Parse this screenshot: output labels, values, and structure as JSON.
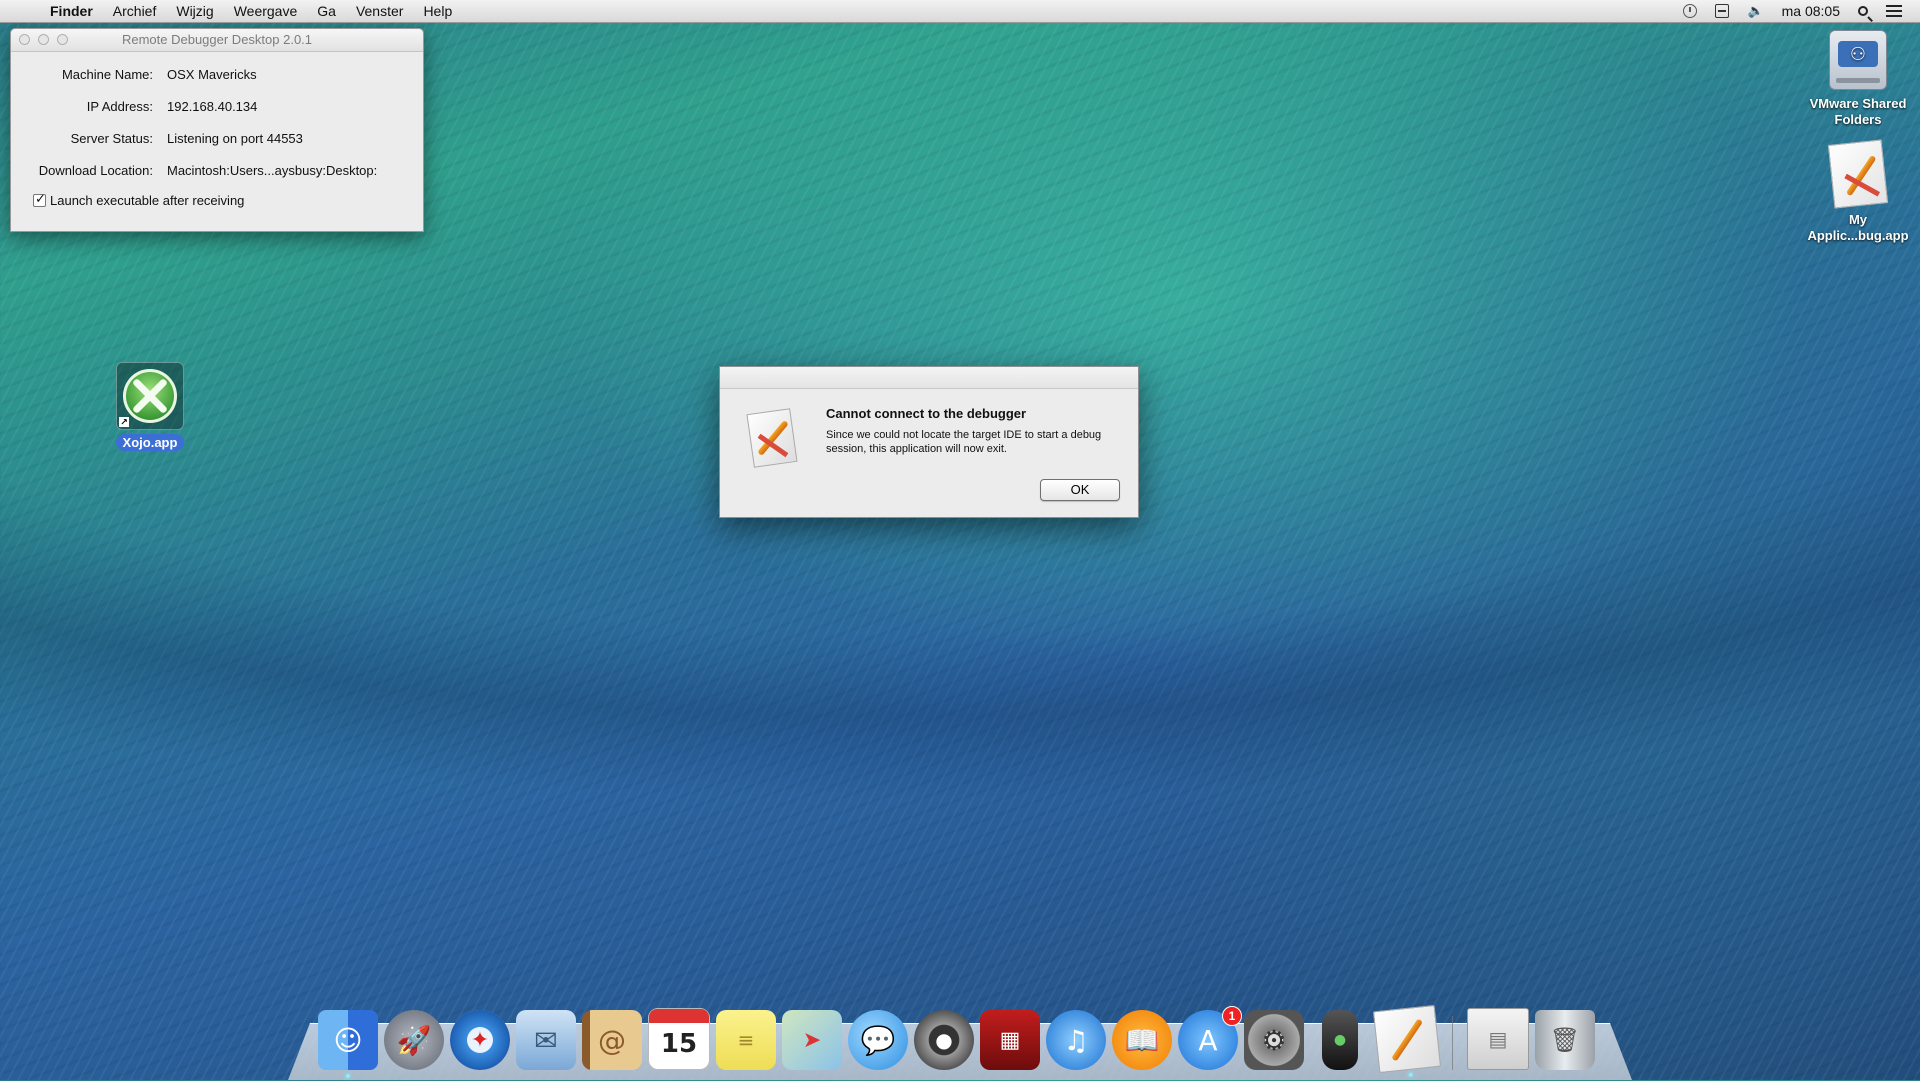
{
  "menubar": {
    "apple": "",
    "items": [
      "Finder",
      "Archief",
      "Wijzig",
      "Weergave",
      "Ga",
      "Venster",
      "Help"
    ],
    "clock": "ma 08:05",
    "status_icons": [
      "time-machine-icon",
      "keyboard-icon",
      "volume-icon",
      "spotlight-search-icon",
      "notification-center-icon"
    ]
  },
  "remote_debugger": {
    "title": "Remote Debugger Desktop 2.0.1",
    "rows": [
      {
        "label": "Machine Name:",
        "value": "OSX Mavericks"
      },
      {
        "label": "IP Address:",
        "value": "192.168.40.134"
      },
      {
        "label": "Server Status:",
        "value": "Listening on port 44553"
      },
      {
        "label": "Download Location:",
        "value": "Macintosh:Users...aysbusy:Desktop:"
      }
    ],
    "launch_checkbox_label": "Launch executable after receiving",
    "launch_checked": true
  },
  "desktop": {
    "xojo_label": "Xojo.app",
    "vmware_label_1": "VMware Shared",
    "vmware_label_2": "Folders",
    "myapp_label_1": "My",
    "myapp_label_2": "Applic...bug.app"
  },
  "alert": {
    "title": "Cannot connect to the debugger",
    "message": "Since we could not locate the target IDE to start a debug session, this application will now exit.",
    "ok_label": "OK"
  },
  "dock": {
    "calendar_day": "15",
    "appstore_badge": "1",
    "items": [
      "finder-icon",
      "launchpad-icon",
      "safari-icon",
      "mail-icon",
      "contacts-icon",
      "calendar-icon",
      "notes-icon",
      "maps-icon",
      "messages-icon",
      "facetime-icon",
      "photo-booth-icon",
      "itunes-icon",
      "ibooks-icon",
      "app-store-icon",
      "system-preferences-icon",
      "remote-icon",
      "debug-app-icon",
      "documents-stack-icon",
      "trash-icon"
    ]
  }
}
